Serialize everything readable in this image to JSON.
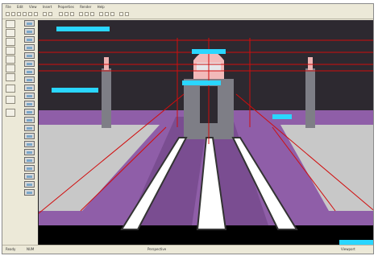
{
  "menubar": {
    "items": [
      "File",
      "Edit",
      "View",
      "Insert",
      "Properties",
      "Render",
      "Help"
    ]
  },
  "statusbar": {
    "left_text": "Ready",
    "mid_text": "NUM",
    "center_text": "Perspective",
    "right_text": "Viewport"
  },
  "viewport_labels": {
    "label_1": "",
    "label_2": "",
    "label_3": "",
    "label_4": "",
    "label_5": "",
    "label_6": ""
  },
  "colors": {
    "accent_cyan": "#2ad6ff",
    "floor_purple": "#8f5ea8",
    "wall_dark": "#2d2930",
    "scene_red": "#d10d0d"
  }
}
